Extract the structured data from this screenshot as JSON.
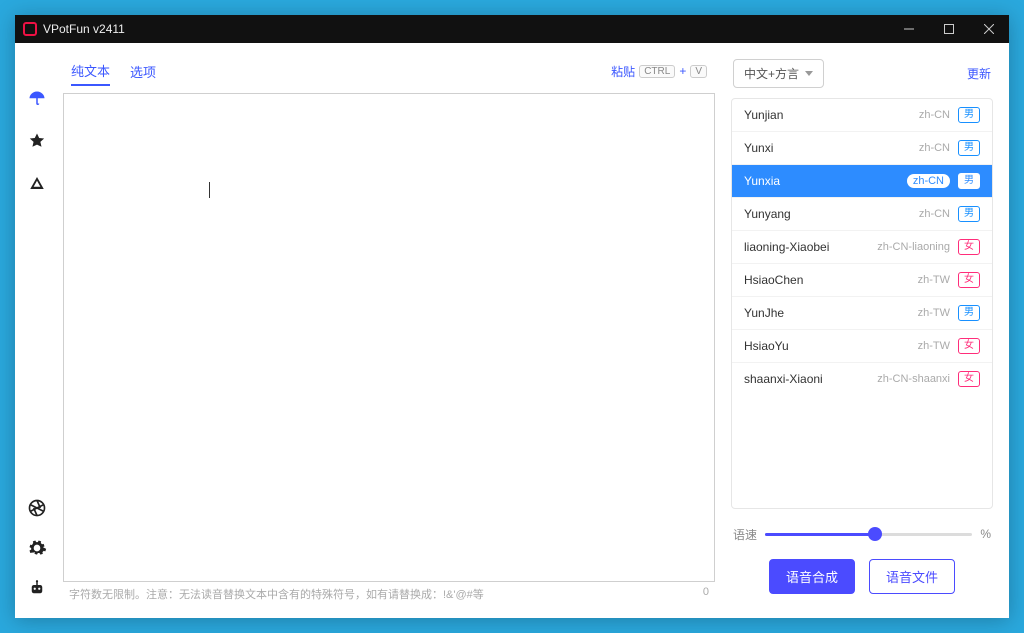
{
  "window": {
    "title": "VPotFun v2411"
  },
  "tabs": {
    "text_label": "纯文本",
    "options_label": "选项"
  },
  "paste": {
    "label": "粘贴",
    "kbd1": "CTRL",
    "kbd_plus": "+",
    "kbd2": "V"
  },
  "hint": {
    "text": "字符数无限制。注意：无法读音替换文本中含有的特殊符号，如有请替换成：!&'@#等",
    "count": "0"
  },
  "filter": {
    "label": "中文+方言"
  },
  "more_link": "更新",
  "voices": [
    {
      "name": "Yunjian",
      "locale": "zh-CN",
      "gender": "男",
      "g": "m"
    },
    {
      "name": "Yunxi",
      "locale": "zh-CN",
      "gender": "男",
      "g": "m"
    },
    {
      "name": "Yunxia",
      "locale": "zh-CN",
      "gender": "男",
      "g": "m",
      "selected": true
    },
    {
      "name": "Yunyang",
      "locale": "zh-CN",
      "gender": "男",
      "g": "m"
    },
    {
      "name": "liaoning-Xiaobei",
      "locale": "zh-CN-liaoning",
      "gender": "女",
      "g": "f"
    },
    {
      "name": "HsiaoChen",
      "locale": "zh-TW",
      "gender": "女",
      "g": "f"
    },
    {
      "name": "YunJhe",
      "locale": "zh-TW",
      "gender": "男",
      "g": "m"
    },
    {
      "name": "HsiaoYu",
      "locale": "zh-TW",
      "gender": "女",
      "g": "f"
    },
    {
      "name": "shaanxi-Xiaoni",
      "locale": "zh-CN-shaanxi",
      "gender": "女",
      "g": "f"
    }
  ],
  "slider": {
    "label": "语速",
    "unit": "%"
  },
  "buttons": {
    "primary": "语音合成",
    "secondary": "语音文件"
  }
}
